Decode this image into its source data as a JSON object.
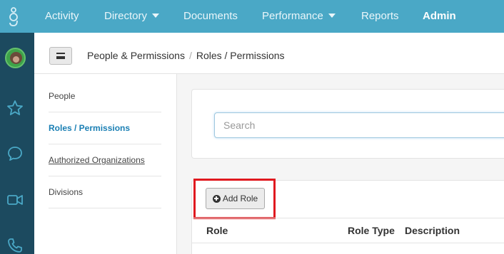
{
  "nav": {
    "logo_icon": "gongshow-logo-icon",
    "items": [
      {
        "label": "Activity",
        "dropdown": false,
        "active": false
      },
      {
        "label": "Directory",
        "dropdown": true,
        "active": false
      },
      {
        "label": "Documents",
        "dropdown": false,
        "active": false
      },
      {
        "label": "Performance",
        "dropdown": true,
        "active": false
      },
      {
        "label": "Reports",
        "dropdown": false,
        "active": false
      },
      {
        "label": "Admin",
        "dropdown": false,
        "active": true
      }
    ]
  },
  "rail": {
    "icons": [
      "avatar",
      "star-icon",
      "chat-bubble-icon",
      "video-camera-icon",
      "phone-icon"
    ]
  },
  "header": {
    "menu_icon": "hamburger-menu-icon",
    "breadcrumb": [
      "People & Permissions",
      "Roles / Permissions"
    ],
    "separator": "/"
  },
  "sidemenu": {
    "items": [
      {
        "label": "People",
        "active": false
      },
      {
        "label": "Roles / Permissions",
        "active": true
      },
      {
        "label": "Authorized Organizations",
        "active": false
      },
      {
        "label": "Divisions",
        "active": false
      }
    ]
  },
  "search": {
    "placeholder": "Search",
    "value": ""
  },
  "roles": {
    "add_button": "Add Role",
    "add_icon": "plus-circle-icon",
    "columns": [
      "Role",
      "Role Type",
      "Description"
    ]
  },
  "colors": {
    "topnav": "#4aa8c6",
    "rail": "#1c4a5f",
    "active_link": "#1a7fb4",
    "highlight": "#e0191f"
  }
}
